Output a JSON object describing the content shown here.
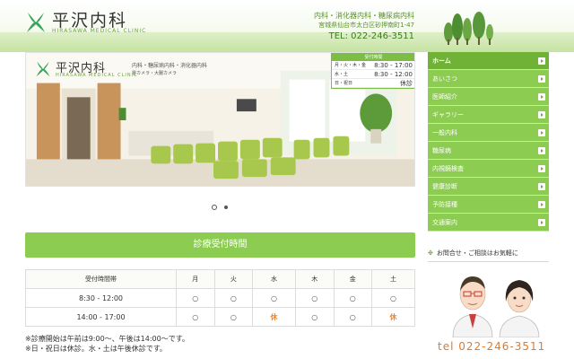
{
  "header": {
    "logo_title": "平沢内科",
    "logo_sub": "HIRASAWA MEDICAL CLINIC",
    "departments": "内科・消化器内科・糖尿病内科",
    "address": "宮城県仙台市太白区砂押南町1-47",
    "tel": "TEL: 022-246-3511"
  },
  "slider": {
    "logo_title": "平沢内科",
    "logo_sub": "HIRASAWA MEDICAL CLINIC",
    "departments": "内科・糖尿病内科・消化器内科",
    "camera": "胃カメラ・大腸カメラ",
    "board_title": "受付時間",
    "board_rows": [
      {
        "label": "月・火・木・金",
        "value": "8:30 - 17:00"
      },
      {
        "label": "水・土",
        "value": "8:30 - 12:00"
      },
      {
        "label": "日・祝日",
        "value": "休診"
      }
    ]
  },
  "hours": {
    "heading": "診療受付時間",
    "col_header": "受付時間帯",
    "days": [
      "月",
      "火",
      "水",
      "木",
      "金",
      "土"
    ],
    "rows": [
      {
        "time": "8:30 - 12:00",
        "cells": [
          "○",
          "○",
          "○",
          "○",
          "○",
          "○"
        ]
      },
      {
        "time": "14:00 - 17:00",
        "cells": [
          "○",
          "○",
          "休",
          "○",
          "○",
          "休"
        ]
      }
    ],
    "notes": [
      "※診療開始は午前は9:00〜、午後は14:00〜です。",
      "※日・祝日は休診。水・土は午後休診です。"
    ]
  },
  "nav": {
    "items": [
      {
        "label": "ホーム"
      },
      {
        "label": "あいさつ"
      },
      {
        "label": "医師紹介"
      },
      {
        "label": "ギャラリー"
      },
      {
        "label": "一般内科"
      },
      {
        "label": "糖尿病"
      },
      {
        "label": "内視鏡検査"
      },
      {
        "label": "健康診断"
      },
      {
        "label": "予防接種"
      },
      {
        "label": "交通案内"
      }
    ]
  },
  "contact": {
    "text": "お問合せ・ご相談はお気軽に",
    "tel": "tel  022-246-3511"
  },
  "colors": {
    "accent": "#8ccc51",
    "accent_dark": "#6fb236",
    "closed": "#e8842c",
    "tel": "#e07a2c"
  },
  "icons": {
    "logo": "clinic-leaf-logo-icon",
    "nav_arrow": "arrow-right-icon",
    "contact": "leaf-icon"
  }
}
